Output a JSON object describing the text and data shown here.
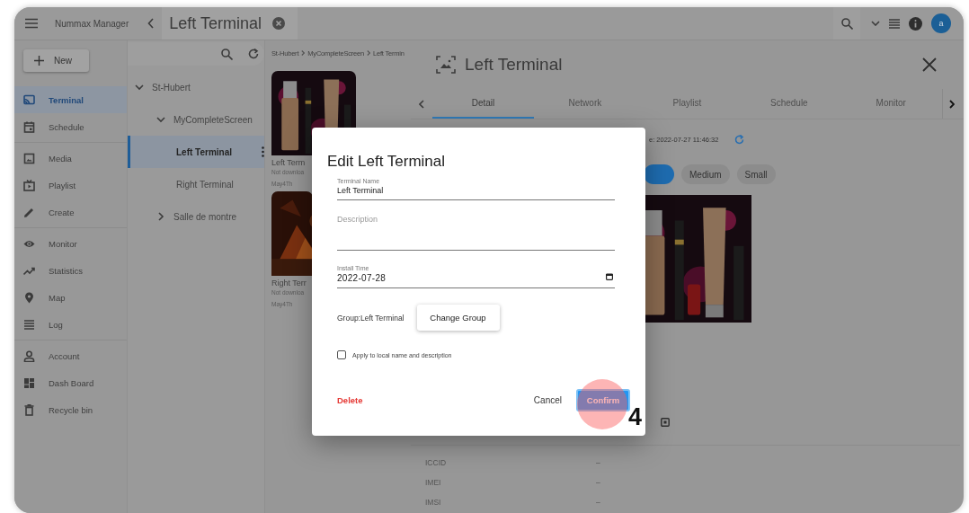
{
  "app_bar": {
    "app_name": "Nummax Manager",
    "tab_title": "Left Terminal",
    "avatar_letter": "a"
  },
  "sidebar": {
    "new_button": "New",
    "sections": [
      {
        "items": [
          {
            "label": "Terminal",
            "selected": true
          },
          {
            "label": "Schedule",
            "selected": false
          }
        ]
      },
      {
        "items": [
          {
            "label": "Media",
            "selected": false
          },
          {
            "label": "Playlist",
            "selected": false
          },
          {
            "label": "Create",
            "selected": false
          }
        ]
      },
      {
        "items": [
          {
            "label": "Monitor",
            "selected": false
          },
          {
            "label": "Statistics",
            "selected": false
          },
          {
            "label": "Map",
            "selected": false
          },
          {
            "label": "Log",
            "selected": false
          }
        ]
      },
      {
        "items": [
          {
            "label": "Account",
            "selected": false
          },
          {
            "label": "Dash Board",
            "selected": false
          },
          {
            "label": "Recycle bin",
            "selected": false
          }
        ]
      }
    ]
  },
  "tree": {
    "items": [
      {
        "label": "St-Hubert",
        "selected": false,
        "expanded": true,
        "children": [
          {
            "label": "MyCompleteScreen",
            "selected": false,
            "expanded": true,
            "children": [
              {
                "label": "Left Terminal",
                "selected": true
              },
              {
                "label": "Right Terminal",
                "selected": false
              }
            ]
          },
          {
            "label": "Salle de montre",
            "selected": false,
            "expanded": false
          }
        ]
      }
    ]
  },
  "breadcrumb": [
    "St-Hubert",
    "MyCompleteScreen",
    "Left Termin"
  ],
  "cards": [
    {
      "title": "Left Term",
      "status": "Not downloa",
      "date": "May4Th"
    },
    {
      "title": "Right Terr",
      "status": "Not downloa",
      "date": "May4Th"
    }
  ],
  "detail": {
    "title": "Left Terminal",
    "tabs": [
      {
        "label": "Detail",
        "selected": true
      },
      {
        "label": "Network",
        "selected": false
      },
      {
        "label": "Playlist",
        "selected": false
      },
      {
        "label": "Schedule",
        "selected": false
      },
      {
        "label": "Monitor",
        "selected": false
      }
    ],
    "update_time": "e: 2022-07-27 11:46:32",
    "chips": [
      {
        "selected": true
      },
      {
        "label": "Medium",
        "selected": false
      },
      {
        "label": "Small",
        "selected": false
      }
    ],
    "info_rows": [
      {
        "label": "ICCID",
        "value": "–"
      },
      {
        "label": "IMEI",
        "value": "–"
      },
      {
        "label": "IMSI",
        "value": "–"
      }
    ]
  },
  "dialog": {
    "title": "Edit Left Terminal",
    "fields": [
      {
        "kind": "text",
        "label": "Terminal Name",
        "value": "Left Terminal"
      },
      {
        "kind": "textarea",
        "placeholder": "Description"
      },
      {
        "kind": "date",
        "label": "Install Time",
        "value": "2022-07-28"
      }
    ],
    "group_text": "Group:Left Terminal",
    "change_group_button": "Change Group",
    "apply_checkbox": {
      "label": "Apply to local name and description",
      "checked": false
    },
    "delete_button": "Delete",
    "cancel_button": "Cancel",
    "confirm_button": "Confirm"
  },
  "tutorial_marker": {
    "step": "4"
  }
}
